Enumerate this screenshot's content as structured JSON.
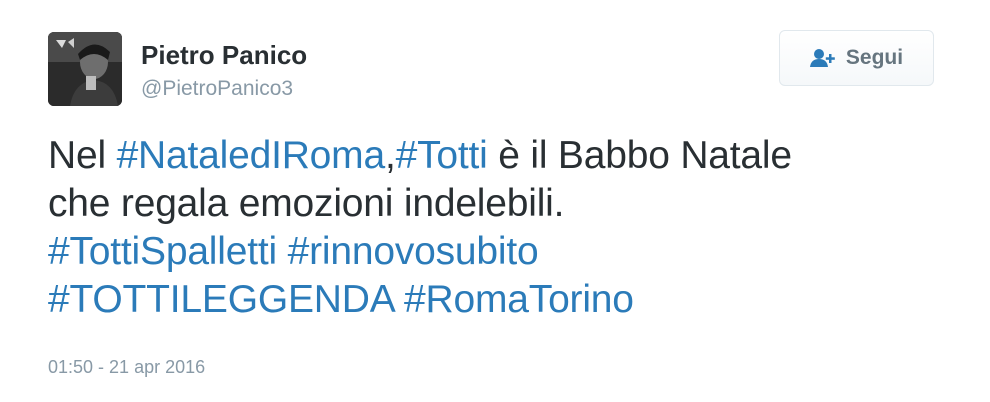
{
  "user": {
    "name": "Pietro Panico",
    "handle": "@PietroPanico3"
  },
  "follow_button": {
    "label": "Segui",
    "icon": "add-user-icon"
  },
  "tweet": {
    "line1": {
      "prefix": "Nel ",
      "tag1": "#NataledIRoma",
      "sep": ",",
      "tag2": "#Totti",
      "suffix": " è il Babbo Natale"
    },
    "line2": "che regala emozioni indelebili.",
    "line3": {
      "tag1": "#TottiSpalletti",
      "tag2": "#rinnovosubito"
    },
    "line4": {
      "tag1": "#TOTTILEGGENDA",
      "tag2": "#RomaTorino"
    },
    "timestamp": "01:50 - 21 apr 2016"
  },
  "colors": {
    "hashtag": "#2b7bb9",
    "text": "#292f33",
    "muted": "#8899a6"
  }
}
